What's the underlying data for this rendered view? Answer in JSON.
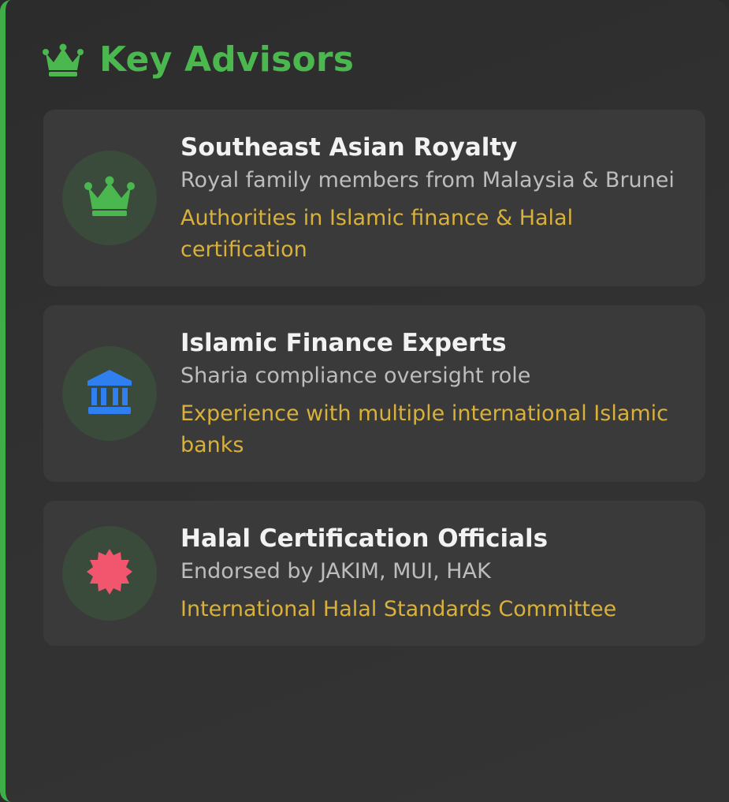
{
  "panel": {
    "title": "Key Advisors",
    "title_icon": "crown-icon",
    "accent_color": "#3fae49"
  },
  "advisors": [
    {
      "icon": "crown-icon",
      "icon_color": "#4bb74f",
      "name": "Southeast Asian Royalty",
      "description": "Royal family members from Malaysia & Brunei",
      "note": "Authorities in Islamic finance & Halal certification"
    },
    {
      "icon": "bank-icon",
      "icon_color": "#2f7ff0",
      "name": "Islamic Finance Experts",
      "description": "Sharia compliance oversight role",
      "note": "Experience with multiple international Islamic banks"
    },
    {
      "icon": "certificate-badge-icon",
      "icon_color": "#f2566e",
      "name": "Halal Certification Officials",
      "description": "Endorsed by JAKIM, MUI, HAK",
      "note": "International Halal Standards Committee"
    }
  ]
}
